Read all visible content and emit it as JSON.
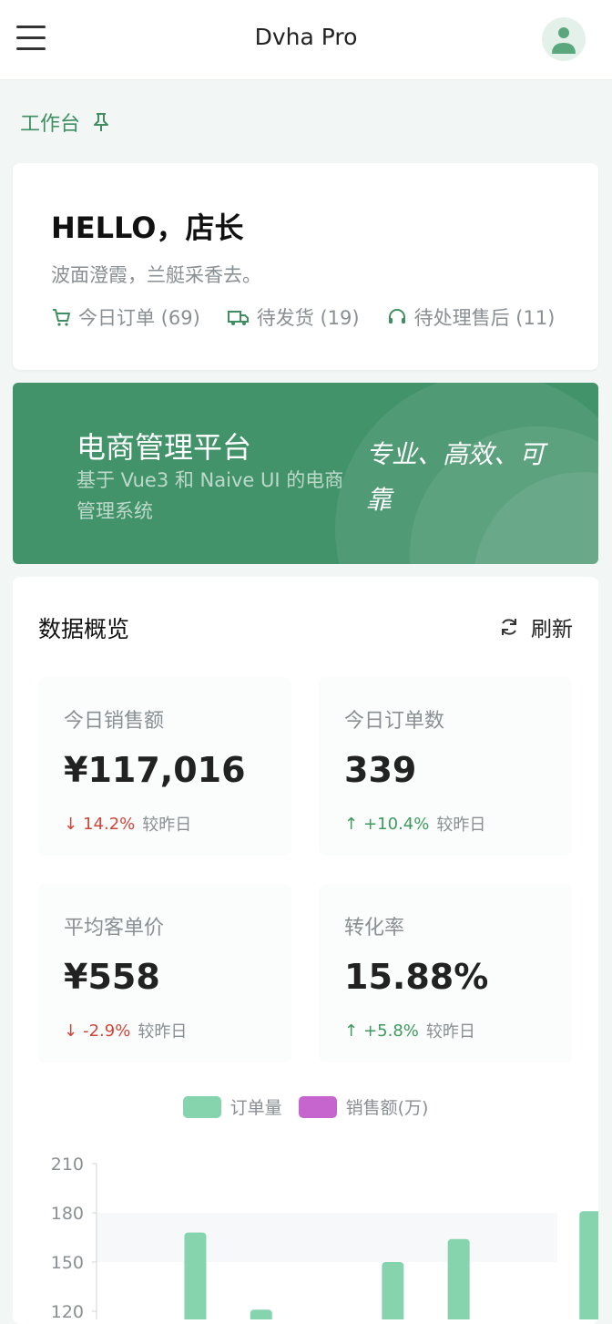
{
  "header": {
    "title": "Dvha Pro",
    "menu_icon": "hamburger-menu-icon",
    "avatar_icon": "user-avatar-icon"
  },
  "breadcrumb": {
    "label": "工作台",
    "pin_icon": "pin-icon"
  },
  "welcome": {
    "title": "HELLO，店长",
    "subtitle": "波面澄霞，兰艇采香去。",
    "stats": [
      {
        "icon": "cart-icon",
        "label": "今日订单 (69)"
      },
      {
        "icon": "truck-icon",
        "label": "待发货 (19)"
      },
      {
        "icon": "headset-icon",
        "label": "待处理售后 (11)"
      }
    ]
  },
  "banner": {
    "title": "电商管理平台",
    "description": "基于 Vue3 和 Naive UI 的电商管理系统",
    "slogan": "专业、高效、可靠"
  },
  "overview": {
    "title": "数据概览",
    "refresh_label": "刷新",
    "kpis": [
      {
        "label": "今日销售额",
        "value": "¥117,016",
        "change": "14.2%",
        "direction": "down",
        "compare": "较昨日"
      },
      {
        "label": "今日订单数",
        "value": "339",
        "change": "+10.4%",
        "direction": "up",
        "compare": "较昨日"
      },
      {
        "label": "平均客单价",
        "value": "¥558",
        "change": "-2.9%",
        "direction": "down",
        "compare": "较昨日"
      },
      {
        "label": "转化率",
        "value": "15.88%",
        "change": "+5.8%",
        "direction": "up",
        "compare": "较昨日"
      }
    ]
  },
  "colors": {
    "accent": "#3e8e61",
    "banner": "#42936a",
    "up": "#3e9a5c",
    "down": "#d0453a",
    "series_orders": "#86d4ad",
    "series_sales": "#c765cf"
  },
  "chart_data": {
    "type": "bar",
    "series": [
      {
        "name": "订单量",
        "values": [
          null,
          168,
          121,
          null,
          150,
          164,
          null,
          181
        ]
      },
      {
        "name": "销售额(万)",
        "values": []
      }
    ],
    "yticks": [
      "210",
      "180",
      "150",
      "120"
    ],
    "ylim": [
      120,
      210
    ],
    "grid": "horizontal bands",
    "legend_position": "top-center"
  }
}
